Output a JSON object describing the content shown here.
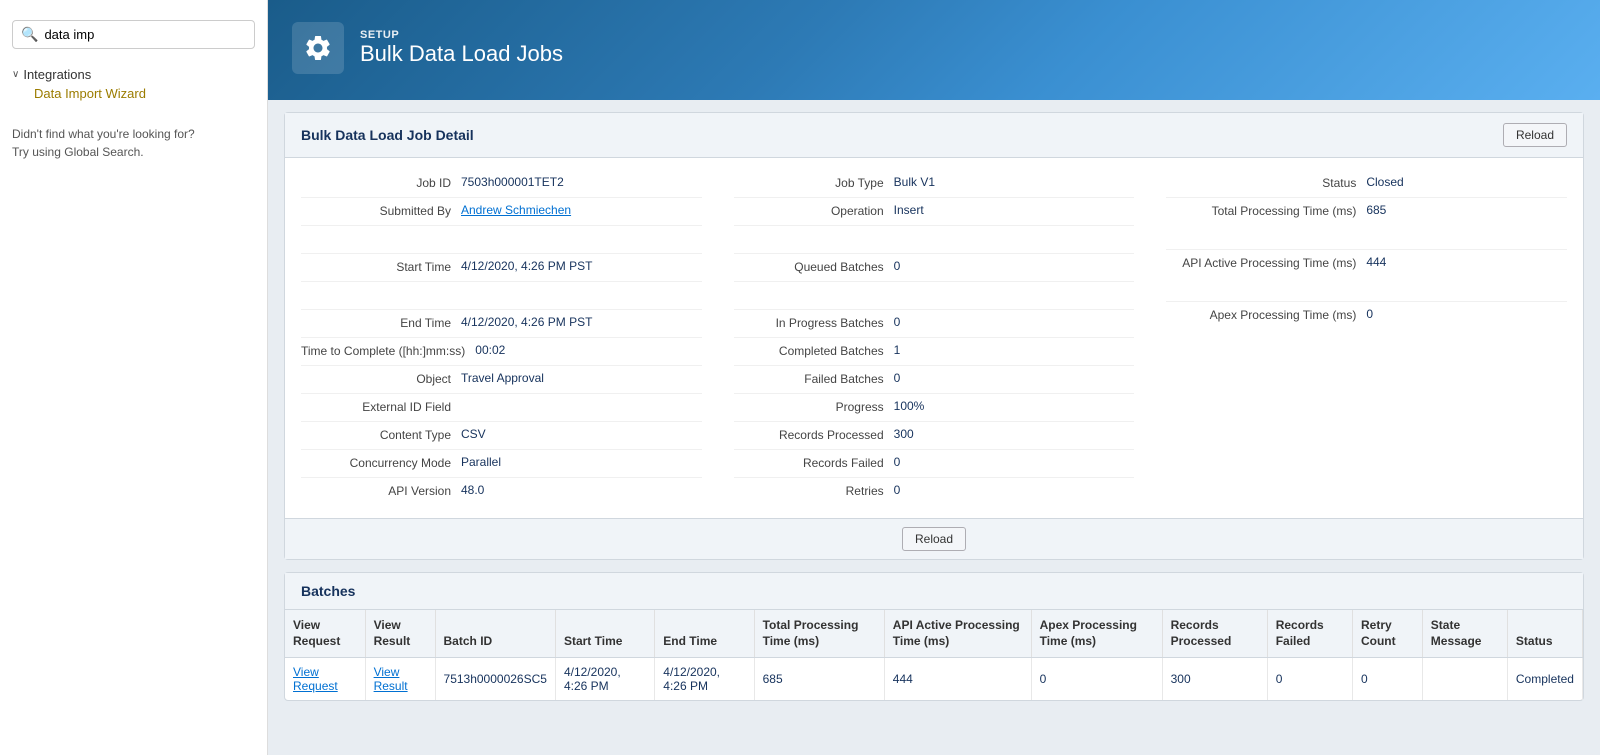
{
  "sidebar": {
    "search_placeholder": "data imp",
    "search_icon": "🔍",
    "section_toggle": "Integrations",
    "nav_item": "Data Import Wizard",
    "help_text": "Didn't find what you're looking for?\nTry using Global Search."
  },
  "banner": {
    "setup_label": "SETUP",
    "title": "Bulk Data Load Jobs",
    "icon_alt": "gear-icon"
  },
  "job_detail": {
    "section_title": "Bulk Data Load Job Detail",
    "reload_label": "Reload",
    "fields": {
      "job_id_label": "Job ID",
      "job_id_value": "7503h000001TET2",
      "submitted_by_label": "Submitted By",
      "submitted_by_value": "Andrew Schmiechen",
      "start_time_label": "Start Time",
      "start_time_value": "4/12/2020, 4:26 PM PST",
      "end_time_label": "End Time",
      "end_time_value": "4/12/2020, 4:26 PM PST",
      "time_to_complete_label": "Time to Complete ([hh:]mm:ss)",
      "time_to_complete_value": "00:02",
      "object_label": "Object",
      "object_value": "Travel Approval",
      "external_id_label": "External ID Field",
      "external_id_value": "",
      "content_type_label": "Content Type",
      "content_type_value": "CSV",
      "concurrency_mode_label": "Concurrency Mode",
      "concurrency_mode_value": "Parallel",
      "api_version_label": "API Version",
      "api_version_value": "48.0",
      "job_type_label": "Job Type",
      "job_type_value": "Bulk V1",
      "operation_label": "Operation",
      "operation_value": "Insert",
      "queued_batches_label": "Queued Batches",
      "queued_batches_value": "0",
      "in_progress_batches_label": "In Progress Batches",
      "in_progress_batches_value": "0",
      "completed_batches_label": "Completed Batches",
      "completed_batches_value": "1",
      "failed_batches_label": "Failed Batches",
      "failed_batches_value": "0",
      "progress_label": "Progress",
      "progress_value": "100%",
      "records_processed_label": "Records Processed",
      "records_processed_value": "300",
      "records_failed_label": "Records Failed",
      "records_failed_value": "0",
      "retries_label": "Retries",
      "retries_value": "0",
      "status_label": "Status",
      "status_value": "Closed",
      "total_processing_time_label": "Total Processing Time (ms)",
      "total_processing_time_value": "685",
      "api_active_processing_time_label": "API Active Processing Time (ms)",
      "api_active_processing_time_value": "444",
      "apex_processing_time_label": "Apex Processing Time (ms)",
      "apex_processing_time_value": "0"
    }
  },
  "batches": {
    "section_title": "Batches",
    "columns": [
      "View Request",
      "View Result",
      "Batch ID",
      "Start Time",
      "End Time",
      "Total Processing Time (ms)",
      "API Active Processing Time (ms)",
      "Apex Processing Time (ms)",
      "Records Processed",
      "Records Failed",
      "Retry Count",
      "State Message",
      "Status"
    ],
    "rows": [
      {
        "view_request": "View Request",
        "view_result": "View Result",
        "batch_id": "7513h0000026SC5",
        "start_time": "4/12/2020, 4:26 PM",
        "end_time": "4/12/2020, 4:26 PM",
        "total_processing_time": "685",
        "api_active_processing_time": "444",
        "apex_processing_time": "0",
        "records_processed": "300",
        "records_failed": "0",
        "retry_count": "0",
        "state_message": "",
        "status": "Completed"
      }
    ]
  }
}
